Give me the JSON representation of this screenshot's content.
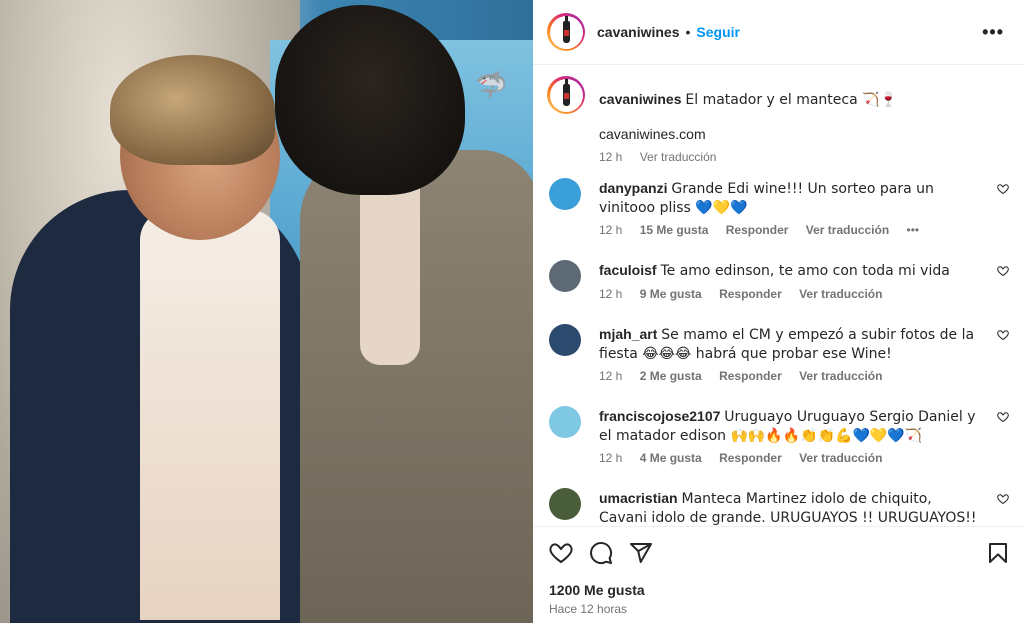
{
  "header": {
    "username": "cavaniwines",
    "dot": "•",
    "follow_label": "Seguir",
    "more_icon": "more-horizontal-icon"
  },
  "caption": {
    "username": "cavaniwines",
    "text": "El matador y el manteca 🏹🍷",
    "link": "cavaniwines.com",
    "time": "12 h",
    "translate": "Ver traducción"
  },
  "comments": [
    {
      "username": "danypanzi",
      "text": "Grande Edi wine!!! Un sorteo para un vinitooo pliss 💙💛💙",
      "time": "12 h",
      "likes": "15 Me gusta",
      "reply": "Responder",
      "translate": "Ver traducción",
      "more": "•••",
      "avatar_color": "#3a9fd8"
    },
    {
      "username": "faculoisf",
      "text": "Te amo edinson, te amo con toda mi vida",
      "time": "12 h",
      "likes": "9 Me gusta",
      "reply": "Responder",
      "translate": "Ver traducción",
      "avatar_color": "#5d6a75"
    },
    {
      "username": "mjah_art",
      "text": "Se mamo el CM y empezó a subir fotos de la fiesta 😂😂😂 habrá que probar ese Wine!",
      "time": "12 h",
      "likes": "2 Me gusta",
      "reply": "Responder",
      "translate": "Ver traducción",
      "avatar_color": "#2c4a6e"
    },
    {
      "username": "franciscojose2107",
      "text": "Uruguayo Uruguayo Sergio Daniel y el matador edison 🙌🙌🔥🔥👏👏💪💙💛💙🏹",
      "time": "12 h",
      "likes": "4 Me gusta",
      "reply": "Responder",
      "translate": "Ver traducción",
      "avatar_color": "#7ec8e3"
    },
    {
      "username": "umacristian",
      "text": "Manteca Martinez idolo de chiquito, Cavani idolo de grande. URUGUAYOS !! URUGUAYOS!!💙💛💙",
      "avatar_color": "#4a5d3a"
    }
  ],
  "actions": {
    "like_icon": "heart-icon",
    "comment_icon": "comment-icon",
    "share_icon": "share-icon",
    "save_icon": "bookmark-icon",
    "likes": "1200 Me gusta",
    "time": "Hace 12 horas"
  },
  "colors": {
    "accent": "#0095f6",
    "text": "#262626",
    "muted": "#737373",
    "border": "#efefef"
  }
}
